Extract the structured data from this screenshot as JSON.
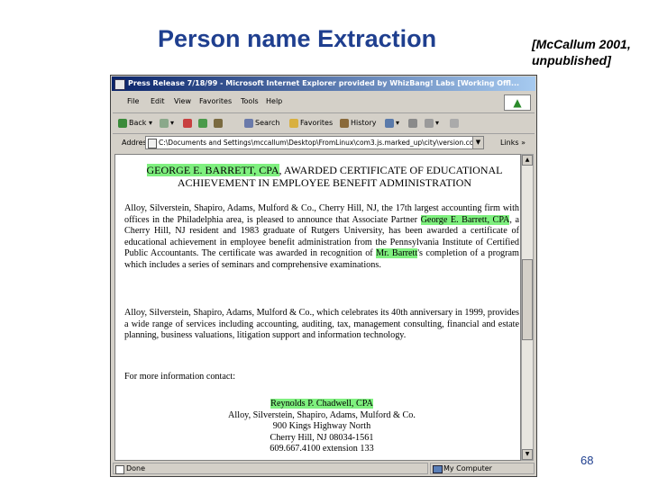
{
  "slide": {
    "title": "Person name Extraction",
    "citation_line1": "[McCallum 2001,",
    "citation_line2": "unpublished]",
    "page_number": "68"
  },
  "browser": {
    "title": "Press Release 7/18/99 - Microsoft Internet Explorer provided by WhizBang! Labs [Working Offl...",
    "menu": [
      "File",
      "Edit",
      "View",
      "Favorites",
      "Tools",
      "Help"
    ],
    "toolbar": {
      "back_label": "Back",
      "search_label": "Search",
      "favorites_label": "Favorites",
      "history_label": "History"
    },
    "address_label": "Address",
    "address_value": "C:\\Documents and Settings\\mccallum\\Desktop\\FromLinux\\com3.js.marked_up\\city\\version.com",
    "links_label": "Links"
  },
  "article": {
    "headline_name": "GEORGE E. BARRETT, CPA",
    "headline_rest": ", AWARDED CERTIFICATE OF EDUCATIONAL ACHIEVEMENT IN EMPLOYEE BENEFIT ADMINISTRATION",
    "p1_a": "Alloy, Silverstein, Shapiro, Adams, Mulford & Co., Cherry Hill, NJ, the 17th largest accounting firm with offices in the Philadelphia area, is pleased to announce that Associate Partner ",
    "p1_name": "George E. Barrett, CPA",
    "p1_b": ", a Cherry Hill, NJ resident and 1983 graduate of Rutgers University, has been awarded a certificate of educational achievement in employee benefit administration from the Pennsylvania Institute of Certified Public Accountants. The certificate was awarded in recognition of ",
    "p1_name2": "Mr. Barrett",
    "p1_c": "'s completion of a program which includes a series of seminars and comprehensive examinations.",
    "p2": "Alloy, Silverstein, Shapiro, Adams, Mulford & Co., which celebrates its 40th anniversary in 1999, provides a wide range of services including accounting, auditing, tax, management consulting, financial and estate planning, business valuations, litigation support and information technology.",
    "p3": "For more information contact:",
    "contact_name": "Reynolds P. Chadwell, CPA",
    "contact_firm": "Alloy, Silverstein, Shapiro, Adams, Mulford & Co.",
    "contact_street": "900 Kings Highway North",
    "contact_city": "Cherry Hill, NJ 08034-1561",
    "contact_phone": "609.667.4100 extension 133"
  },
  "status": {
    "left": "Done",
    "right": "My Computer"
  }
}
